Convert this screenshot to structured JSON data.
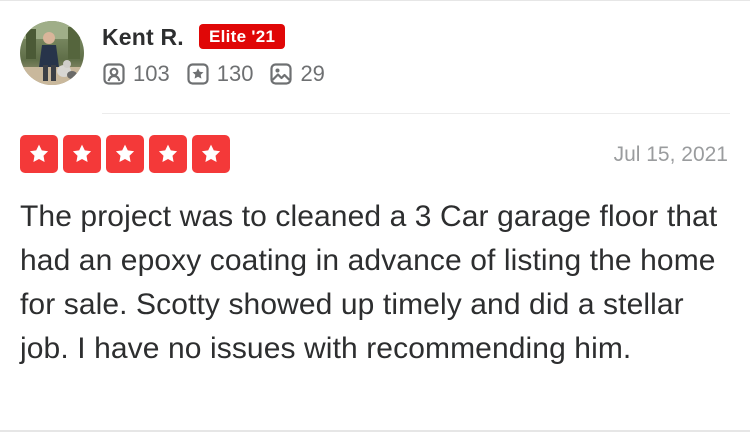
{
  "user": {
    "name": "Kent R.",
    "elite_badge": "Elite '21"
  },
  "stats": [
    {
      "icon": "friends-icon",
      "value": "103"
    },
    {
      "icon": "review-star-icon",
      "value": "130"
    },
    {
      "icon": "photo-icon",
      "value": "29"
    }
  ],
  "review": {
    "rating": 5,
    "rating_max": 5,
    "date": "Jul 15, 2021",
    "text": "The project was to cleaned a 3 Car garage floor that had an epoxy coating in advance of listing the home for sale. Scotty showed up timely and did a stellar job. I have no issues with recommending him."
  },
  "colors": {
    "accent_red": "#e00707",
    "star_red": "#f43939",
    "text_primary": "#2d2e2f",
    "text_muted": "#6e7072"
  }
}
